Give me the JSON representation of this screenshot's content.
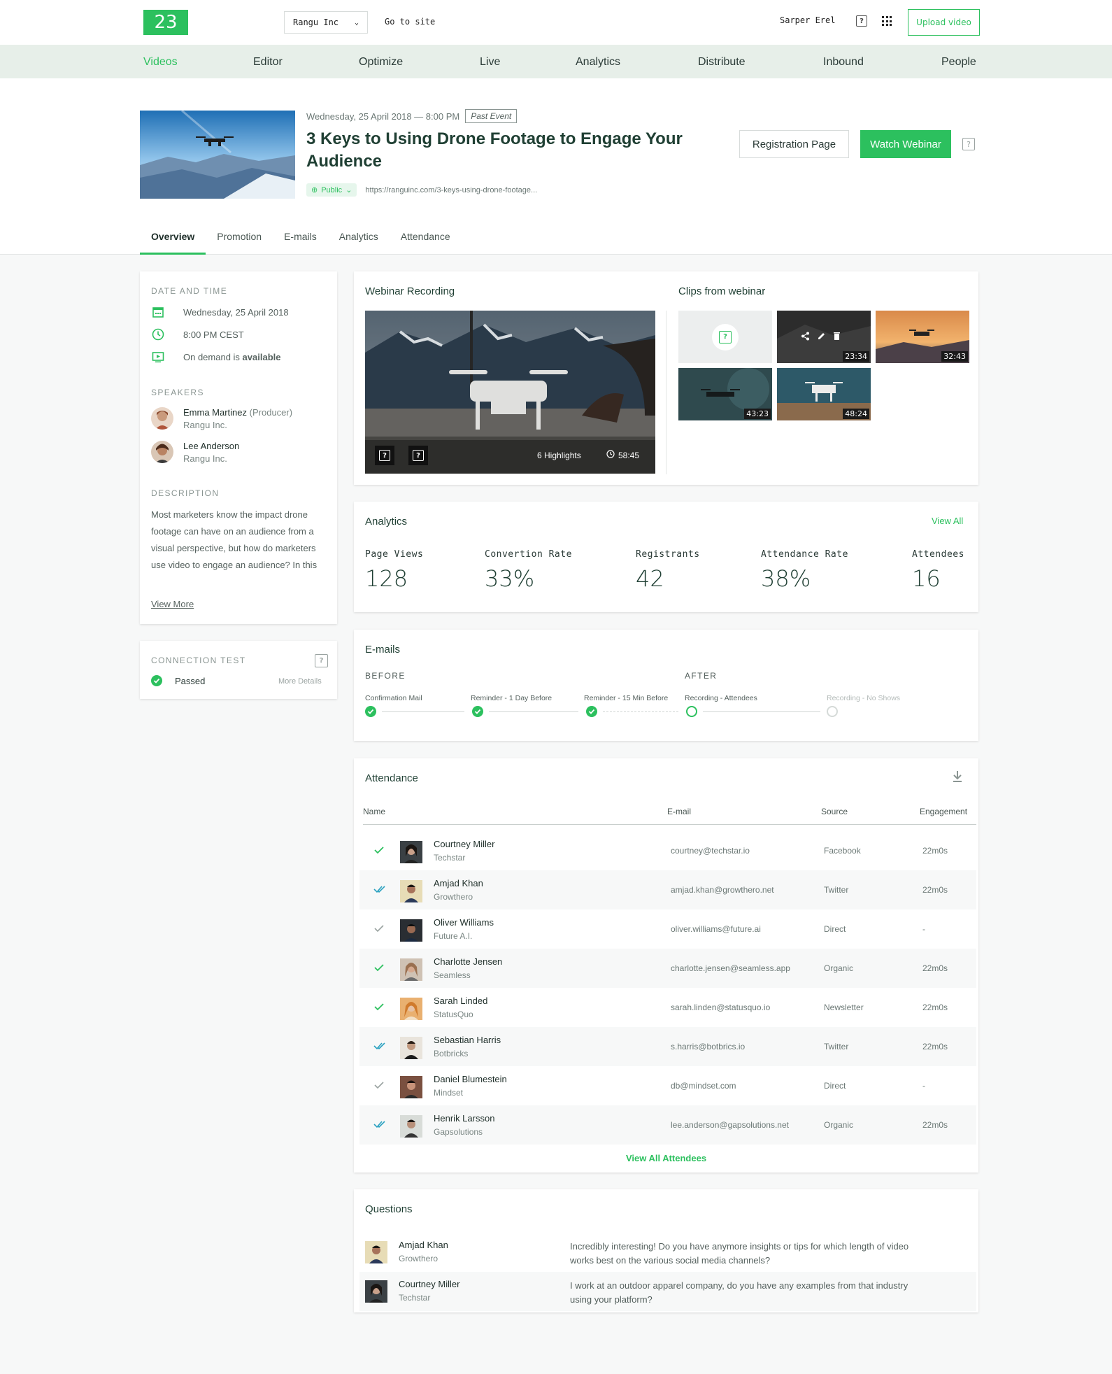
{
  "topbar": {
    "logo": "23",
    "org": "Rangu Inc",
    "goto": "Go to site",
    "user": "Sarper Erel",
    "upload": "Upload video"
  },
  "nav": [
    "Videos",
    "Editor",
    "Optimize",
    "Live",
    "Analytics",
    "Distribute",
    "Inbound",
    "People"
  ],
  "event": {
    "datetime": "Wednesday, 25 April 2018 — 8:00 PM",
    "badge": "Past Event",
    "title": "3 Keys to Using Drone Footage to Engage Your Audience",
    "visibility": "Public",
    "url": "https://ranguinc.com/3-keys-using-drone-footage...",
    "registration_btn": "Registration Page",
    "watch_btn": "Watch Webinar"
  },
  "tabs": [
    "Overview",
    "Promotion",
    "E-mails",
    "Analytics",
    "Attendance"
  ],
  "sidebar": {
    "date_label": "DATE AND TIME",
    "date": "Wednesday, 25 April 2018",
    "time": "8:00 PM CEST",
    "demand_prefix": "On demand is ",
    "demand_value": "available",
    "speakers_label": "SPEAKERS",
    "speakers": [
      {
        "name": "Emma Martinez",
        "role": "(Producer)",
        "company": "Rangu Inc."
      },
      {
        "name": "Lee Anderson",
        "role": "",
        "company": "Rangu Inc."
      }
    ],
    "description_label": "DESCRIPTION",
    "description": "Most marketers know the impact drone footage can have on an audience from a visual perspective, but how do marketers use video to engage an audience? In this webinar, we'll answer all the questions",
    "view_more": "View More",
    "connection_label": "CONNECTION TEST",
    "connection_status": "Passed",
    "more_details": "More Details"
  },
  "recording": {
    "title": "Webinar Recording",
    "highlights": "6 Highlights",
    "duration": "58:45",
    "clips_title": "Clips from webinar",
    "clips": [
      "23:34",
      "32:43",
      "43:23",
      "48:24"
    ]
  },
  "analytics": {
    "title": "Analytics",
    "view_all": "View All",
    "stats": [
      {
        "label": "Page Views",
        "value": "128"
      },
      {
        "label": "Convertion Rate",
        "value": "33%"
      },
      {
        "label": "Registrants",
        "value": "42"
      },
      {
        "label": "Attendance Rate",
        "value": "38%"
      },
      {
        "label": "Attendees",
        "value": "16"
      }
    ]
  },
  "emails": {
    "title": "E-mails",
    "before": "BEFORE",
    "after": "AFTER",
    "steps": [
      "Confirmation Mail",
      "Reminder - 1 Day Before",
      "Reminder - 15 Min Before",
      "Recording - Attendees",
      "Recording - No Shows"
    ]
  },
  "attendance": {
    "title": "Attendance",
    "headers": [
      "Name",
      "E-mail",
      "Source",
      "Engagement"
    ],
    "rows": [
      {
        "name": "Courtney Miller",
        "company": "Techstar",
        "email": "courtney@techstar.io",
        "source": "Facebook",
        "engagement": "22m0s"
      },
      {
        "name": "Amjad Khan",
        "company": "Growthero",
        "email": "amjad.khan@growthero.net",
        "source": "Twitter",
        "engagement": "22m0s"
      },
      {
        "name": "Oliver Williams",
        "company": "Future A.I.",
        "email": "oliver.williams@future.ai",
        "source": "Direct",
        "engagement": "-"
      },
      {
        "name": "Charlotte Jensen",
        "company": "Seamless",
        "email": "charlotte.jensen@seamless.app",
        "source": "Organic",
        "engagement": "22m0s"
      },
      {
        "name": "Sarah Linded",
        "company": "StatusQuo",
        "email": "sarah.linden@statusquo.io",
        "source": "Newsletter",
        "engagement": "22m0s"
      },
      {
        "name": "Sebastian Harris",
        "company": "Botbricks",
        "email": "s.harris@botbrics.io",
        "source": "Twitter",
        "engagement": "22m0s"
      },
      {
        "name": "Daniel Blumestein",
        "company": "Mindset",
        "email": "db@mindset.com",
        "source": "Direct",
        "engagement": "-"
      },
      {
        "name": "Henrik Larsson",
        "company": "Gapsolutions",
        "email": "lee.anderson@gapsolutions.net",
        "source": "Organic",
        "engagement": "22m0s"
      }
    ],
    "view_all": "View All Attendees"
  },
  "questions": {
    "title": "Questions",
    "items": [
      {
        "name": "Amjad Khan",
        "company": "Growthero",
        "text": "Incredibly interesting! Do you have anymore insights or tips for which length of video works best on the various social media channels?"
      },
      {
        "name": "Courtney Miller",
        "company": "Techstar",
        "text": "I work at an outdoor apparel company, do you have any examples from that industry using your platform?"
      }
    ]
  },
  "colors": {
    "accent": "#2cc05e",
    "nav_bg": "#e7efe9",
    "title": "#1f3f33"
  }
}
